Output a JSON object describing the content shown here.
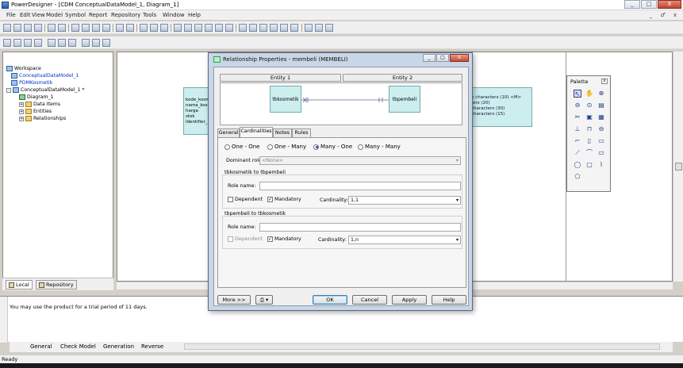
{
  "window": {
    "title": "PowerDesigner - [CDM ConceptualDataModel_1, Diagram_1]",
    "controls": [
      "_",
      "□",
      "X"
    ],
    "mdi_controls": "_ ♂ x"
  },
  "menu": [
    "File",
    "Edit",
    "View",
    "Model",
    "Symbol",
    "Report",
    "Repository",
    "Tools",
    "Window",
    "Help"
  ],
  "browser": {
    "tree": [
      {
        "label": "Workspace",
        "level": 0
      },
      {
        "label": "ConceptualDataModel_1",
        "level": 1
      },
      {
        "label": "PDMKosmetik",
        "level": 1
      },
      {
        "label": "ConceptualDataModel_1 *",
        "level": 1
      },
      {
        "label": "Diagram_1",
        "level": 2
      },
      {
        "label": "Data Items",
        "level": 2
      },
      {
        "label": "Entities",
        "level": 2
      },
      {
        "label": "Relationships",
        "level": 2
      }
    ],
    "tabs": [
      "Local",
      "Repository"
    ]
  },
  "canvas": {
    "entity_left": {
      "lines": [
        "kode_kosm",
        "nama_kos",
        "harga",
        "stok",
        "Identifier_"
      ]
    },
    "entity_right": {
      "lines": [
        "n characters (10)  <M>",
        "ters (20)",
        "characters (30)",
        "characters (15)"
      ]
    }
  },
  "palette": {
    "title": "Palette",
    "close": "x",
    "icons": [
      "pointer-icon",
      "grabber-icon",
      "zoom-in-icon",
      "zoom-out-icon",
      "open-package-icon",
      "properties-icon",
      "delete-icon",
      "package-icon",
      "entity-icon",
      "inheritance-icon",
      "relationship-icon",
      "association-icon",
      "link-icon",
      "file-icon",
      "line-icon",
      "arc-icon",
      "rectangle-icon",
      "ellipse-icon",
      "rounded-rectangle-icon",
      "polyline-icon",
      "polygon-icon"
    ]
  },
  "output": {
    "message": "You may use the product for a trial period of 11 days.",
    "tabs": [
      "General",
      "Check Model",
      "Generation",
      "Reverse"
    ]
  },
  "status": "Ready",
  "dialog": {
    "title": "Relationship Properties - membeli (MEMBELI)",
    "entity1_header": "Entity 1",
    "entity2_header": "Entity 2",
    "entity1": "tbkosmetik",
    "entity2": "tbpembeli",
    "tabs": [
      "General",
      "Cardinalities",
      "Notes",
      "Rules"
    ],
    "active_tab": "Cardinalities",
    "cardinality_options": [
      "One - One",
      "One - Many",
      "Many - One",
      "Many - Many"
    ],
    "selected_cardinality": "Many - One",
    "dominant_role_label": "Dominant role:",
    "dominant_role_value": "<None>",
    "group1": {
      "title": "tbkosmetik to tbpembeli",
      "role_label": "Role name:",
      "role_value": "",
      "dependent_label": "Dependent",
      "mandatory_label": "Mandatory",
      "cardinality_label": "Cardinality:",
      "cardinality_value": "1,1"
    },
    "group2": {
      "title": "tbpembeli to tbkosmetik",
      "role_label": "Role name:",
      "role_value": "",
      "dependent_label": "Dependent",
      "mandatory_label": "Mandatory",
      "cardinality_label": "Cardinality:",
      "cardinality_value": "1,n"
    },
    "buttons": {
      "more": "More >>",
      "ok": "OK",
      "cancel": "Cancel",
      "apply": "Apply",
      "help": "Help"
    }
  }
}
